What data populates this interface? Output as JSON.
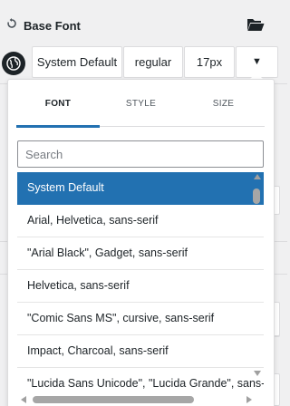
{
  "header": {
    "title": "Base Font",
    "reset_icon": "reset-icon",
    "folder_icon": "open-folder-icon"
  },
  "controls": {
    "globe_icon": "globe-icon",
    "family_value": "System Default",
    "style_value": "regular",
    "size_value": "17px",
    "toggle_symbol": "▼"
  },
  "dropdown": {
    "tabs": [
      {
        "label": "FONT",
        "active": true
      },
      {
        "label": "STYLE",
        "active": false
      },
      {
        "label": "SIZE",
        "active": false
      }
    ],
    "search": {
      "placeholder": "Search",
      "value": ""
    },
    "font_list": [
      "System Default",
      "Arial, Helvetica, sans-serif",
      "\"Arial Black\", Gadget, sans-serif",
      "Helvetica, sans-serif",
      "\"Comic Sans MS\", cursive, sans-serif",
      "Impact, Charcoal, sans-serif",
      "\"Lucida Sans Unicode\", \"Lucida Grande\", sans-serif"
    ],
    "selected_index": 0
  },
  "colors": {
    "accent": "#2271b1",
    "background": "#f0f0f1",
    "text": "#1d2327"
  }
}
